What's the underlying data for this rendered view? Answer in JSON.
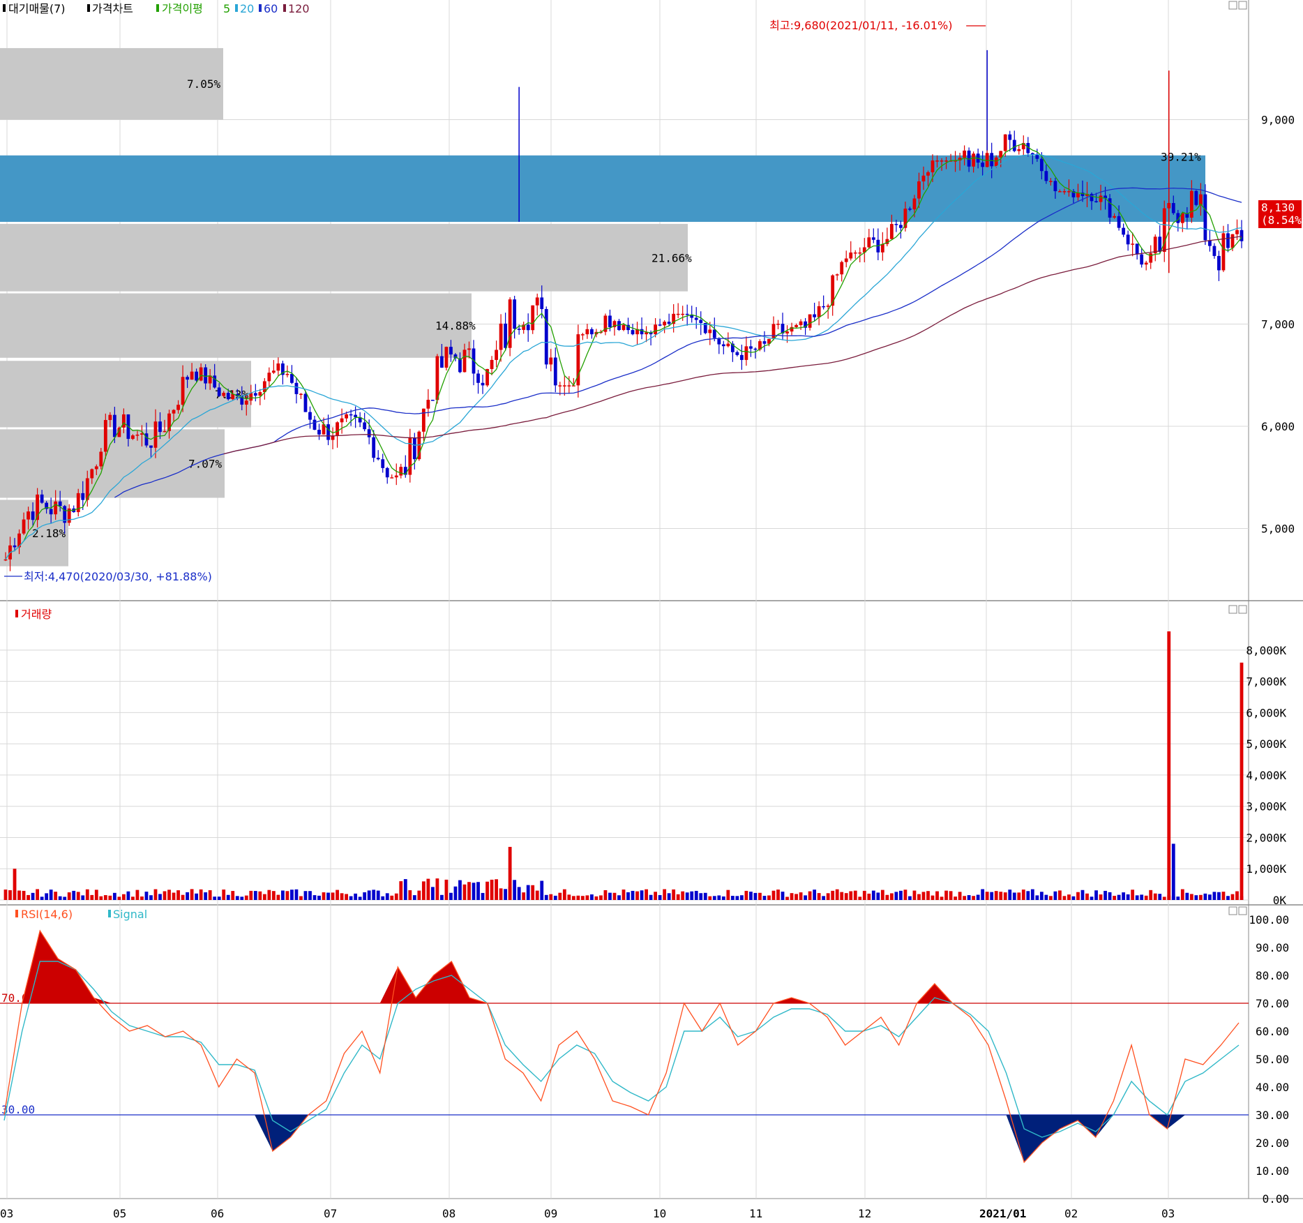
{
  "window": {
    "main_legend": [
      "대기매물(7)",
      "가격차트",
      "가격이평",
      "5",
      "20",
      "60",
      "120"
    ],
    "volume_legend": "거래량",
    "rsi_legend": [
      "RSI(14,6)",
      "Signal"
    ]
  },
  "colors": {
    "up": "#e00000",
    "down": "#0000cc",
    "ma5": "#22a000",
    "ma20": "#2aa6d6",
    "ma60": "#1a2ec8",
    "ma120": "#7a1c3c",
    "supply_box": "#c8c8c8",
    "supply_highlight": "#4497c6",
    "grid": "#d8d8d8",
    "rsi": "#ff5020",
    "signal": "#30b8c8",
    "overbought_fill": "#cc0000",
    "oversold_fill": "#00207a"
  },
  "chart_data": [
    {
      "type": "candlestick",
      "panel": "price",
      "x_ticks": [
        "03",
        "05",
        "06",
        "07",
        "08",
        "09",
        "10",
        "11",
        "12",
        "2021/01",
        "02",
        "03"
      ],
      "y_ticks": [
        "5,000",
        "6,000",
        "7,000",
        "9,000"
      ],
      "ylim": [
        4300,
        10000
      ],
      "last_price": "8,130",
      "last_change": "(8.54%)",
      "annotations": {
        "high": "최고:9,680(2021/01/11, -16.01%)",
        "low": "최저:4,470(2020/03/30, +81.88%)"
      },
      "supply_zones": [
        {
          "low": 9000,
          "high": 9700,
          "pct": "7.05%",
          "highlight": false
        },
        {
          "low": 8000,
          "high": 8650,
          "pct": "39.21%",
          "highlight": true
        },
        {
          "low": 7320,
          "high": 7980,
          "pct": "21.66%",
          "highlight": false
        },
        {
          "low": 6670,
          "high": 7300,
          "pct": "14.88%",
          "highlight": false
        },
        {
          "low": 5990,
          "high": 6640,
          "pct": "7.13%",
          "highlight": false
        },
        {
          "low": 5300,
          "high": 5970,
          "pct": "7.07%",
          "highlight": false
        },
        {
          "low": 4630,
          "high": 5280,
          "pct": "2.18%",
          "highlight": false
        }
      ],
      "candles_monthly_summary": [
        {
          "month": "03",
          "open": 4700,
          "close": 5700,
          "high": 5900,
          "low": 4470
        },
        {
          "month": "04",
          "open": 5700,
          "close": 6400,
          "high": 6800,
          "low": 5400
        },
        {
          "month": "05",
          "open": 6400,
          "close": 6400,
          "high": 6800,
          "low": 5900
        },
        {
          "month": "06",
          "open": 6400,
          "close": 5600,
          "high": 6500,
          "low": 5300
        },
        {
          "month": "07",
          "open": 5600,
          "close": 6800,
          "high": 7300,
          "low": 5500
        },
        {
          "month": "08",
          "open": 6800,
          "close": 6800,
          "high": 9320,
          "low": 6400
        },
        {
          "month": "09",
          "open": 6800,
          "close": 7100,
          "high": 8000,
          "low": 6900
        },
        {
          "month": "10",
          "open": 7100,
          "close": 6700,
          "high": 7100,
          "low": 6300
        },
        {
          "month": "11",
          "open": 6700,
          "close": 7700,
          "high": 7700,
          "low": 6600
        },
        {
          "month": "12",
          "open": 7700,
          "close": 8800,
          "high": 8600,
          "low": 7600
        },
        {
          "month": "2021/01",
          "open": 8800,
          "close": 8500,
          "high": 9680,
          "low": 8400
        },
        {
          "month": "02",
          "open": 8500,
          "close": 7700,
          "high": 8300,
          "low": 7500
        },
        {
          "month": "03",
          "open": 7700,
          "close": 8130,
          "high": 9480,
          "low": 6930
        }
      ]
    },
    {
      "type": "bar",
      "panel": "volume",
      "y_ticks": [
        "0K",
        "1,000K",
        "2,000K",
        "3,000K",
        "4,000K",
        "5,000K",
        "6,000K",
        "7,000K",
        "8,000K"
      ],
      "ylim": [
        0,
        8600
      ],
      "notable_bars": [
        {
          "x": "2020/03/31",
          "value": 1000
        },
        {
          "x": "2020/08/11",
          "value": 1700
        },
        {
          "x": "2021/03/09",
          "value": 8700
        },
        {
          "x": "2021/03/10",
          "value": 1800
        },
        {
          "x": "2021/03/25",
          "value": 7600
        }
      ]
    },
    {
      "type": "line",
      "panel": "rsi",
      "y_ticks": [
        "0.00",
        "10.00",
        "20.00",
        "30.00",
        "40.00",
        "50.00",
        "60.00",
        "70.00",
        "80.00",
        "90.00",
        "100.00"
      ],
      "ylim": [
        0,
        100
      ],
      "levels": [
        "70.00",
        "30.00"
      ],
      "series": [
        {
          "name": "RSI(14,6)",
          "values": [
            30,
            70,
            96,
            86,
            82,
            72,
            65,
            60,
            62,
            58,
            60,
            55,
            40,
            50,
            45,
            17,
            22,
            30,
            35,
            52,
            60,
            45,
            83,
            72,
            80,
            85,
            72,
            70,
            50,
            45,
            35,
            55,
            60,
            50,
            35,
            33,
            30,
            45,
            70,
            60,
            70,
            55,
            60,
            70,
            72,
            70,
            65,
            55,
            60,
            65,
            55,
            70,
            77,
            70,
            65,
            55,
            35,
            13,
            20,
            25,
            28,
            22,
            35,
            55,
            30,
            25,
            50,
            48,
            55,
            63
          ]
        },
        {
          "name": "Signal",
          "values": [
            28,
            60,
            85,
            85,
            82,
            75,
            67,
            62,
            60,
            58,
            58,
            56,
            48,
            48,
            46,
            28,
            24,
            28,
            32,
            45,
            55,
            50,
            70,
            75,
            78,
            80,
            75,
            70,
            55,
            48,
            42,
            50,
            55,
            52,
            42,
            38,
            35,
            40,
            60,
            60,
            65,
            58,
            60,
            65,
            68,
            68,
            66,
            60,
            60,
            62,
            58,
            65,
            72,
            70,
            66,
            60,
            45,
            25,
            22,
            24,
            27,
            24,
            30,
            42,
            35,
            30,
            42,
            45,
            50,
            55
          ]
        }
      ]
    }
  ]
}
